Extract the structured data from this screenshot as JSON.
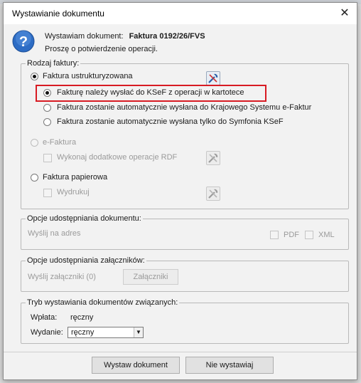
{
  "window": {
    "title": "Wystawianie dokumentu",
    "close_glyph": "✕"
  },
  "message": {
    "line1_prefix": "Wystawiam dokument:",
    "document_number": "Faktura 0192/26/FVS",
    "line2": "Proszę o potwierdzenie operacji."
  },
  "invoice_type": {
    "legend": "Rodzaj faktury:",
    "structured": {
      "label": "Faktura ustrukturyzowana",
      "checked": true,
      "options": [
        {
          "label": "Fakturę należy wysłać do KSeF z operacji w kartotece",
          "checked": true,
          "highlighted": true
        },
        {
          "label": "Faktura zostanie automatycznie wysłana do Krajowego Systemu e-Faktur",
          "checked": false
        },
        {
          "label": "Faktura zostanie automatycznie wysłana tylko do Symfonia KSeF",
          "checked": false
        }
      ]
    },
    "efaktura": {
      "label": "e-Faktura",
      "enabled": false,
      "sub_option": "Wykonaj dodatkowe operacje RDF"
    },
    "paper": {
      "label": "Faktura papierowa",
      "checked": false,
      "sub_option": "Wydrukuj"
    }
  },
  "sharing": {
    "legend": "Opcje udostępniania dokumentu:",
    "send_to": "Wyślij na adres",
    "pdf": "PDF",
    "xml": "XML"
  },
  "attachments": {
    "legend": "Opcje udostępniania załączników:",
    "send": "Wyślij załączniki (0)",
    "button": "Załączniki"
  },
  "related": {
    "legend": "Tryb wystawiania dokumentów związanych:",
    "payment_label": "Wpłata:",
    "payment_value": "ręczny",
    "issue_label": "Wydanie:",
    "issue_value": "ręczny"
  },
  "buttons": {
    "issue": "Wystaw dokument",
    "cancel": "Nie wystawiaj"
  },
  "colors": {
    "highlight": "#d81b23",
    "question_icon": "#2d6cc4"
  },
  "icons": {
    "question": "question-icon",
    "settings_tool": "tools-icon"
  }
}
